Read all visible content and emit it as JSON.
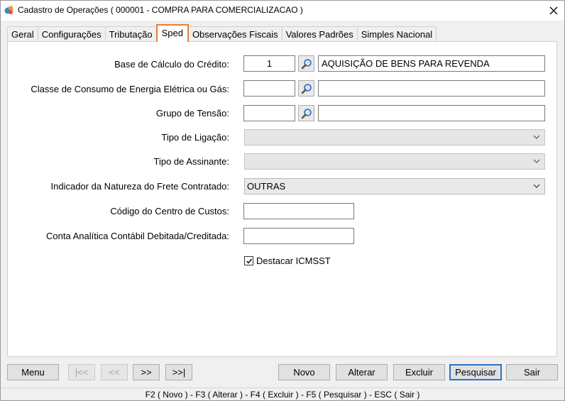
{
  "window": {
    "title": "Cadastro de Operações ( 000001 - COMPRA PARA COMERCIALIZACAO )"
  },
  "tabs": [
    {
      "label": "Geral"
    },
    {
      "label": "Configurações"
    },
    {
      "label": "Tributação"
    },
    {
      "label": "Sped",
      "active": true
    },
    {
      "label": "Observações Fiscais"
    },
    {
      "label": "Valores Padrões"
    },
    {
      "label": "Simples Nacional"
    }
  ],
  "form": {
    "base_calculo": {
      "label": "Base de Cálculo do Crédito:",
      "code": "1",
      "description": "AQUISIÇÃO DE BENS PARA REVENDA"
    },
    "classe_consumo": {
      "label": "Classe de Consumo de Energia Elétrica ou Gás:",
      "code": "",
      "description": ""
    },
    "grupo_tensao": {
      "label": "Grupo de Tensão:",
      "code": "",
      "description": ""
    },
    "tipo_ligacao": {
      "label": "Tipo de Ligação:",
      "value": ""
    },
    "tipo_assinante": {
      "label": "Tipo de Assinante:",
      "value": ""
    },
    "natureza_frete": {
      "label": "Indicador da Natureza do Frete Contratado:",
      "value": "OUTRAS"
    },
    "centro_custos": {
      "label": "Código do Centro de Custos:",
      "value": ""
    },
    "conta_analitica": {
      "label": "Conta Analítica Contábil Debitada/Creditada:",
      "value": ""
    },
    "destacar_icmsst": {
      "label": "Destacar ICMSST",
      "checked": true
    }
  },
  "buttons": {
    "menu": "Menu",
    "first": "|<<",
    "prev": "<<",
    "next": ">>",
    "last": ">>|",
    "novo": "Novo",
    "alterar": "Alterar",
    "excluir": "Excluir",
    "pesquisar": "Pesquisar",
    "sair": "Sair"
  },
  "status": {
    "shortcuts": "F2 ( Novo )  -  F3 ( Alterar )  -  F4 ( Excluir )  -  F5 ( Pesquisar )  -  ESC ( Sair )"
  },
  "colors": {
    "active_tab_border": "#ee7d31",
    "focus_border": "#2a74c7"
  }
}
